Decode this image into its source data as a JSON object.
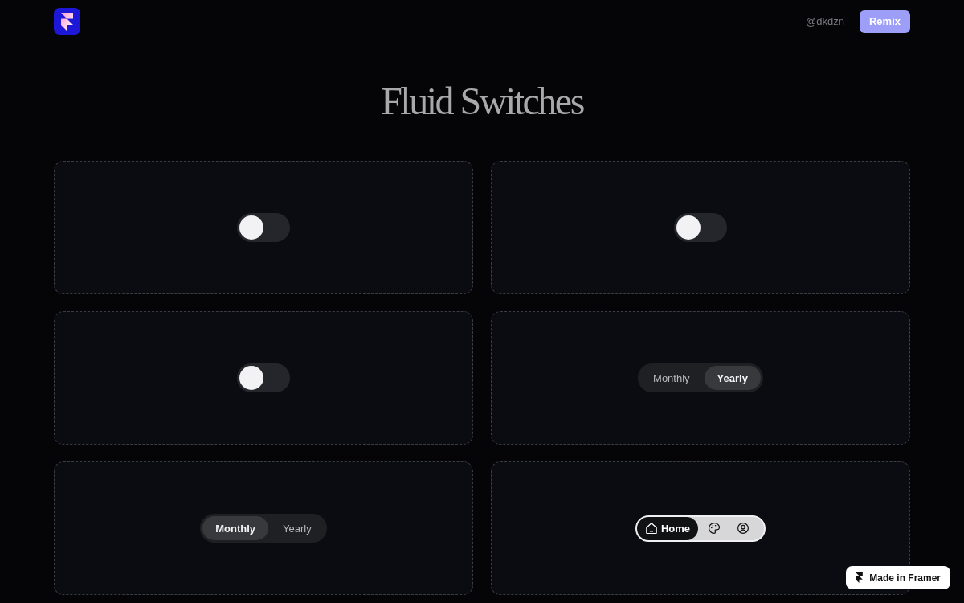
{
  "header": {
    "handle": "@dkdzn",
    "button": "Remix"
  },
  "title": "Fluid Switches",
  "cards": [
    {
      "kind": "toggle",
      "on": false
    },
    {
      "kind": "toggle",
      "on": false
    },
    {
      "kind": "toggle",
      "on": false
    },
    {
      "kind": "segmented",
      "options": [
        {
          "label": "Monthly",
          "selected": false
        },
        {
          "label": "Yearly",
          "selected": true
        }
      ]
    },
    {
      "kind": "segmented",
      "options": [
        {
          "label": "Monthly",
          "selected": true
        },
        {
          "label": "Yearly",
          "selected": false
        }
      ]
    },
    {
      "kind": "nav",
      "items": [
        {
          "label": "Home",
          "selected": true
        },
        {
          "selected": false
        },
        {
          "selected": false
        }
      ]
    }
  ],
  "badge": {
    "label": "Made in Framer"
  }
}
